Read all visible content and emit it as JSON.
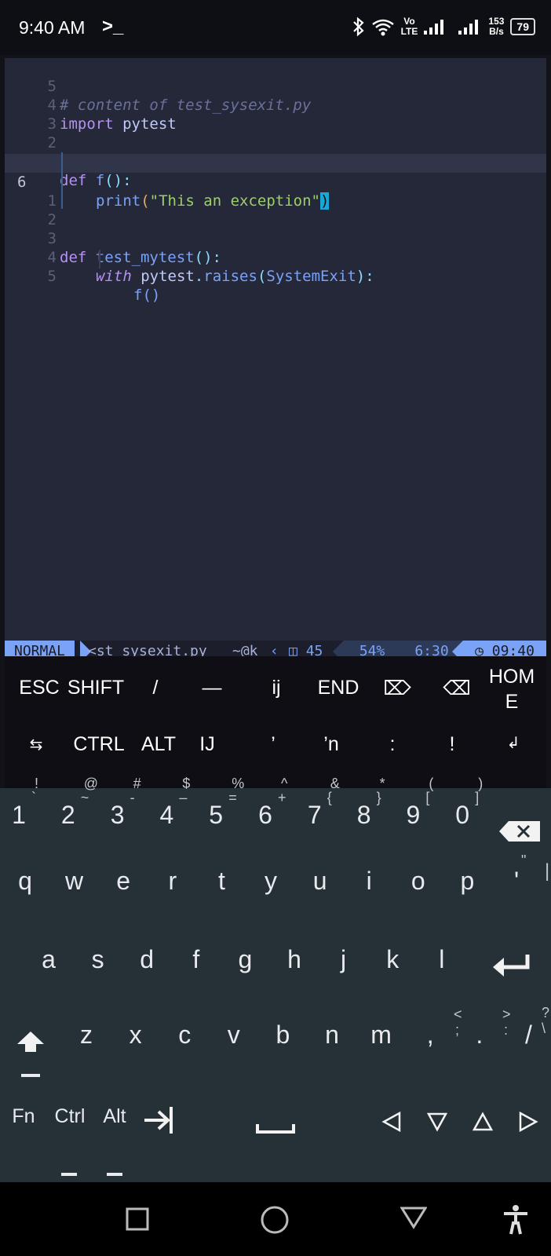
{
  "status_bar": {
    "time": "9:40 AM",
    "prompt_icon": "terminal-prompt-icon",
    "net_speed_value": "153",
    "net_speed_unit": "B/s",
    "battery": "79",
    "volte": "Vo",
    "lte": "LTE"
  },
  "editor": {
    "lines": [
      {
        "num": "5",
        "text": "# content of test_sysexit.py"
      },
      {
        "num": "4",
        "text": "import pytest"
      },
      {
        "num": "3",
        "text": ""
      },
      {
        "num": "2",
        "text": ""
      },
      {
        "num": "1",
        "text": "def f():"
      },
      {
        "num": "6",
        "text": "print(\"This an exception\")"
      },
      {
        "num": "1",
        "text": ""
      },
      {
        "num": "2",
        "text": ""
      },
      {
        "num": "3",
        "text": "def test_mytest():"
      },
      {
        "num": "4",
        "text": "with pytest.raises(SystemExit):"
      },
      {
        "num": "5",
        "text": "f()"
      }
    ]
  },
  "statusline": {
    "mode": "NORMAL",
    "file": "<st_sysexit.py",
    "branch": "~@k",
    "buffer_count": "45",
    "percent": "54%",
    "position": "6:30",
    "clock": "09:40"
  },
  "extra_keys": {
    "row1": [
      "ESC",
      "SHIFT",
      "/",
      "—",
      "ij",
      "END",
      "⌦",
      "⌫",
      "HOM E"
    ],
    "row2": [
      "⇆",
      "CTRL",
      "ALT",
      "IJ",
      "’",
      "’n",
      ":",
      "!",
      "↲"
    ]
  },
  "keyboard": {
    "number_row": [
      {
        "main": "1",
        "top": "!",
        "sub": "`"
      },
      {
        "main": "2",
        "top": "@",
        "sub": "~"
      },
      {
        "main": "3",
        "top": "#",
        "sub": "-"
      },
      {
        "main": "4",
        "top": "$",
        "sub": "–"
      },
      {
        "main": "5",
        "top": "%",
        "sub": "="
      },
      {
        "main": "6",
        "top": "^",
        "sub": "+"
      },
      {
        "main": "7",
        "top": "&",
        "sub": "{"
      },
      {
        "main": "8",
        "top": "*",
        "sub": "}"
      },
      {
        "main": "9",
        "top": "(",
        "sub": "["
      },
      {
        "main": "0",
        "top": ")",
        "sub": "]"
      }
    ],
    "row_q": [
      "q",
      "w",
      "e",
      "r",
      "t",
      "y",
      "u",
      "i",
      "o",
      "p",
      "'"
    ],
    "row_a": [
      "a",
      "s",
      "d",
      "f",
      "g",
      "h",
      "j",
      "k",
      "l"
    ],
    "row_z": [
      "z",
      "x",
      "c",
      "v",
      "b",
      "n",
      "m",
      ",",
      ".",
      "/"
    ],
    "row_z_alts": [
      "<",
      ";",
      ">",
      ":",
      "?",
      "\\"
    ],
    "q_row_alts": [
      "\"",
      "|"
    ],
    "bottom": {
      "fn": "Fn",
      "ctrl": "Ctrl",
      "alt": "Alt"
    }
  },
  "colors": {
    "editor_bg": "#252839",
    "keyboard_bg": "#263137",
    "accent": "#7aa2f7"
  }
}
